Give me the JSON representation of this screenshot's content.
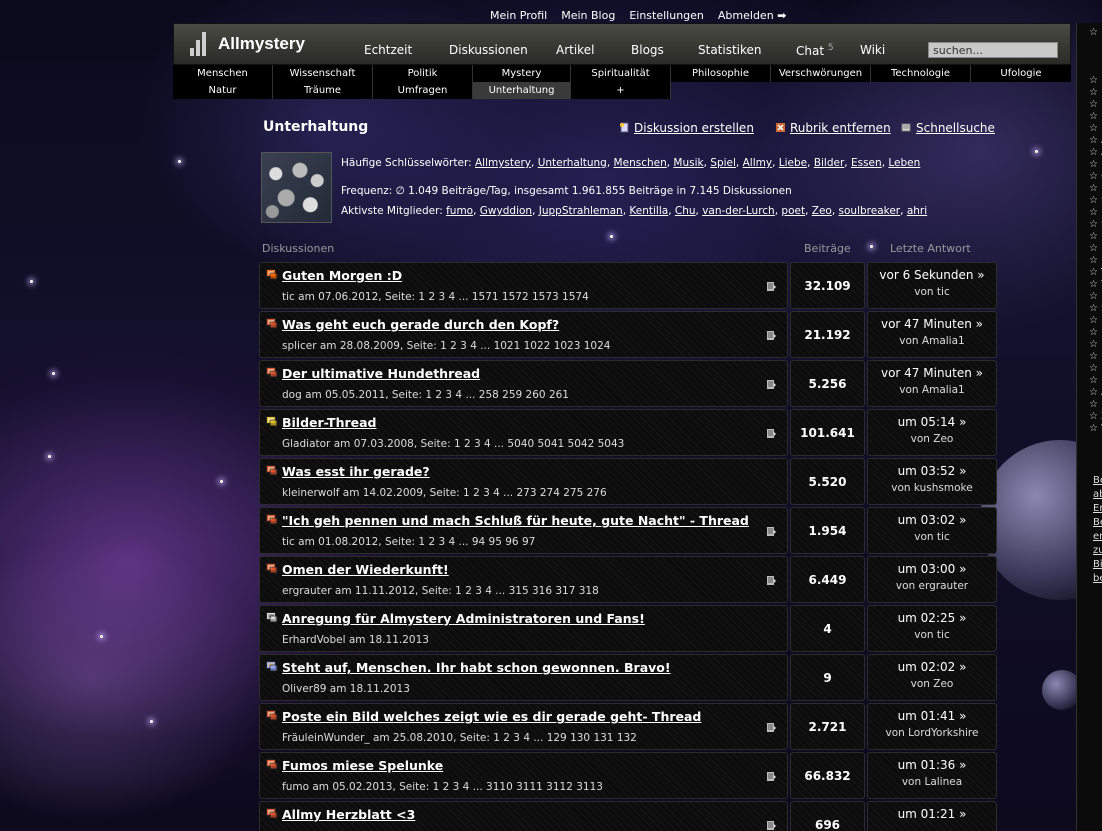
{
  "top_links": [
    "Mein Profil",
    "Mein Blog",
    "Einstellungen",
    "Abmelden ➡"
  ],
  "header": {
    "title": "Allmystery",
    "nav": [
      {
        "label": "Echtzeit"
      },
      {
        "label": "Diskussionen"
      },
      {
        "label": "Artikel"
      },
      {
        "label": "Blogs"
      },
      {
        "label": "Statistiken"
      },
      {
        "label": "Chat",
        "badge": "5"
      },
      {
        "label": "Wiki"
      }
    ],
    "search_placeholder": "suchen..."
  },
  "categories": {
    "row1": [
      "Menschen",
      "Wissenschaft",
      "Politik",
      "Mystery",
      "Spiritualität",
      "Philosophie",
      "Verschwörungen",
      "Technologie",
      "Ufologie"
    ],
    "row2": [
      "Natur",
      "Träume",
      "Umfragen",
      "Unterhaltung",
      "+"
    ],
    "active": "Unterhaltung"
  },
  "page": {
    "title": "Unterhaltung",
    "actions": {
      "create": "Diskussion erstellen",
      "remove": "Rubrik entfernen",
      "quicksearch": "Schnellsuche"
    },
    "keywords_label": "Häufige Schlüsselwörter:",
    "keywords": [
      "Allmystery",
      "Unterhaltung",
      "Menschen",
      "Musik",
      "Spiel",
      "Allmy",
      "Liebe",
      "Bilder",
      "Essen",
      "Leben"
    ],
    "frequency": "Frequenz: ∅ 1.049 Beiträge/Tag, insgesamt 1.961.855 Beiträge in 7.145 Diskussionen",
    "members_label": "Aktivste Mitglieder:",
    "members": [
      "fumo",
      "Gwyddion",
      "JuppStrahleman",
      "Kentilla",
      "Chu",
      "van-der-Lurch",
      "poet",
      "Zeo",
      "soulbreaker",
      "ahri"
    ]
  },
  "table": {
    "col_discussions": "Diskussionen",
    "col_posts": "Beiträge",
    "col_last": "Letzte Antwort"
  },
  "threads": [
    {
      "title": "Guten Morgen :D",
      "meta": "tic am 07.06.2012, Seite: 1 2 3 4 ... 1571 1572 1573 1574",
      "posts": "32.109",
      "last": "vor 6 Sekunden »",
      "by": "von tic",
      "icon": "sticky-icon",
      "doc": true
    },
    {
      "title": "Was geht euch gerade durch den Kopf?",
      "meta": "splicer am 28.08.2009, Seite: 1 2 3 4 ... 1021 1022 1023 1024",
      "posts": "21.192",
      "last": "vor 47 Minuten »",
      "by": "von Amalia1",
      "icon": "hot-thread-icon",
      "doc": true
    },
    {
      "title": "Der ultimative Hundethread",
      "meta": "dog am 05.05.2011, Seite: 1 2 3 4 ... 258 259 260 261",
      "posts": "5.256",
      "last": "vor 47 Minuten »",
      "by": "von Amalia1",
      "icon": "hot-thread-icon",
      "doc": true
    },
    {
      "title": "Bilder-Thread",
      "meta": "Gladiator am 07.03.2008, Seite: 1 2 3 4 ... 5040 5041 5042 5043",
      "posts": "101.641",
      "last": "um 05:14 »",
      "by": "von Zeo",
      "icon": "image-thread-icon",
      "doc": true
    },
    {
      "title": "Was esst ihr gerade?",
      "meta": "kleinerwolf am 14.02.2009, Seite: 1 2 3 4 ... 273 274 275 276",
      "posts": "5.520",
      "last": "um 03:52 »",
      "by": "von kushsmoke",
      "icon": "hot-thread-icon",
      "doc": false
    },
    {
      "title": "\"Ich geh pennen und mach Schluß für heute, gute Nacht\" - Thread",
      "meta": "tic am 01.08.2012, Seite: 1 2 3 4 ... 94 95 96 97",
      "posts": "1.954",
      "last": "um 03:02 »",
      "by": "von tic",
      "icon": "hot-thread-icon",
      "doc": true
    },
    {
      "title": "Omen der Wiederkunft!",
      "meta": "ergrauter am 11.11.2012, Seite: 1 2 3 4 ... 315 316 317 318",
      "posts": "6.449",
      "last": "um 03:00 »",
      "by": "von ergrauter",
      "icon": "hot-thread-icon",
      "doc": true
    },
    {
      "title": "Anregung für Almystery Administratoren und Fans!",
      "meta": "ErhardVobel am 18.11.2013",
      "posts": "4",
      "last": "um 02:25 »",
      "by": "von tic",
      "icon": "thread-icon",
      "doc": false
    },
    {
      "title": "Steht auf, Menschen. Ihr habt schon gewonnen. Bravo!",
      "meta": "Oliver89 am 18.11.2013",
      "posts": "9",
      "last": "um 02:02 »",
      "by": "von Zeo",
      "icon": "new-thread-icon",
      "doc": false
    },
    {
      "title": "Poste ein Bild welches zeigt wie es dir gerade geht- Thread",
      "meta": "FräuleinWunder_ am 25.08.2010, Seite: 1 2 3 4 ... 129 130 131 132",
      "posts": "2.721",
      "last": "um 01:41 »",
      "by": "von LordYorkshire",
      "icon": "hot-thread-icon",
      "doc": true
    },
    {
      "title": "Fumos miese Spelunke",
      "meta": "fumo am 05.02.2013, Seite: 1 2 3 4 ... 3110 3111 3112 3113",
      "posts": "66.832",
      "last": "um 01:36 »",
      "by": "von Lalinea",
      "icon": "hot-thread-icon",
      "doc": true
    },
    {
      "title": "Allmy Herzblatt <3",
      "meta": "",
      "posts": "696",
      "last": "um 01:21 »",
      "by": "",
      "icon": "hot-thread-icon",
      "doc": true
    }
  ],
  "sidebar": {
    "lines": [
      "☆ I",
      "☆ B",
      "☆ D",
      "☆ D",
      "☆ E",
      "☆ E",
      "☆ A",
      "☆ A",
      "☆ D",
      "☆ G",
      "☆ P",
      "☆ S",
      "☆ E",
      "☆ S",
      "☆ I",
      "☆ P",
      "☆ L",
      "☆ T",
      "☆ Y",
      "☆ F",
      "☆ S",
      "☆ P",
      "☆ K",
      "☆ L",
      "☆ E",
      "☆ N",
      "☆ L",
      "☆ A",
      "☆ P",
      "☆ Z",
      "☆ V"
    ],
    "texts": [
      "Be",
      "ab",
      "Er",
      "Be",
      "er",
      "zu",
      "Bi",
      "be"
    ]
  }
}
